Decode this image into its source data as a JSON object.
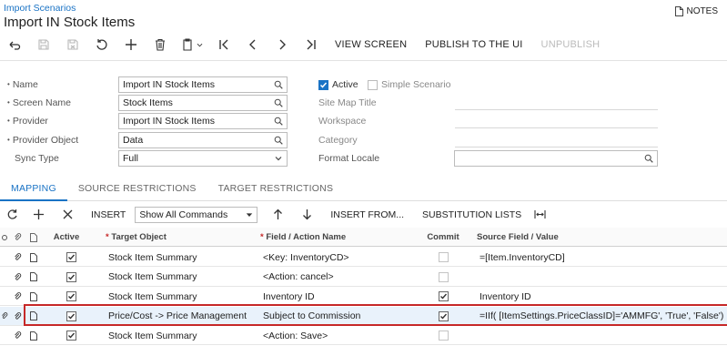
{
  "header": {
    "breadcrumb": "Import Scenarios",
    "title": "Import IN Stock Items",
    "notes_label": "NOTES"
  },
  "toolbar": {
    "view_screen": "VIEW SCREEN",
    "publish": "PUBLISH TO THE UI",
    "unpublish": "UNPUBLISH"
  },
  "form": {
    "name_label": "Name",
    "name_value": "Import IN Stock Items",
    "screen_label": "Screen Name",
    "screen_value": "Stock Items",
    "provider_label": "Provider",
    "provider_value": "Import IN Stock Items",
    "provider_object_label": "Provider Object",
    "provider_object_value": "Data",
    "sync_label": "Sync Type",
    "sync_value": "Full",
    "active_label": "Active",
    "simple_label": "Simple Scenario",
    "sitemap_label": "Site Map Title",
    "workspace_label": "Workspace",
    "category_label": "Category",
    "locale_label": "Format Locale"
  },
  "tabs": [
    "MAPPING",
    "SOURCE RESTRICTIONS",
    "TARGET RESTRICTIONS"
  ],
  "gridbar": {
    "insert": "INSERT",
    "show_all": "Show All Commands",
    "insert_from": "INSERT FROM...",
    "substitution": "SUBSTITUTION LISTS"
  },
  "grid": {
    "headers": {
      "active": "Active",
      "target": "Target Object",
      "field": "Field / Action Name",
      "commit": "Commit",
      "source": "Source Field / Value"
    },
    "rows": [
      {
        "active": true,
        "target": "Stock Item Summary",
        "field": "<Key: InventoryCD>",
        "commit": false,
        "source": "=[Item.InventoryCD]"
      },
      {
        "active": true,
        "target": "Stock Item Summary",
        "field": "<Action: cancel>",
        "commit": false,
        "source": ""
      },
      {
        "active": true,
        "target": "Stock Item Summary",
        "field": "Inventory ID",
        "commit": true,
        "source": "Inventory ID"
      },
      {
        "active": true,
        "target": "Price/Cost -> Price Management",
        "field": "Subject to Commission",
        "commit": true,
        "source": "=IIf( [ItemSettings.PriceClassID]='AMMFG', 'True', 'False')"
      },
      {
        "active": true,
        "target": "Stock Item Summary",
        "field": "<Action: Save>",
        "commit": false,
        "source": ""
      }
    ]
  },
  "colors": {
    "accent": "#1a73c5",
    "highlight_border": "#c62828"
  }
}
